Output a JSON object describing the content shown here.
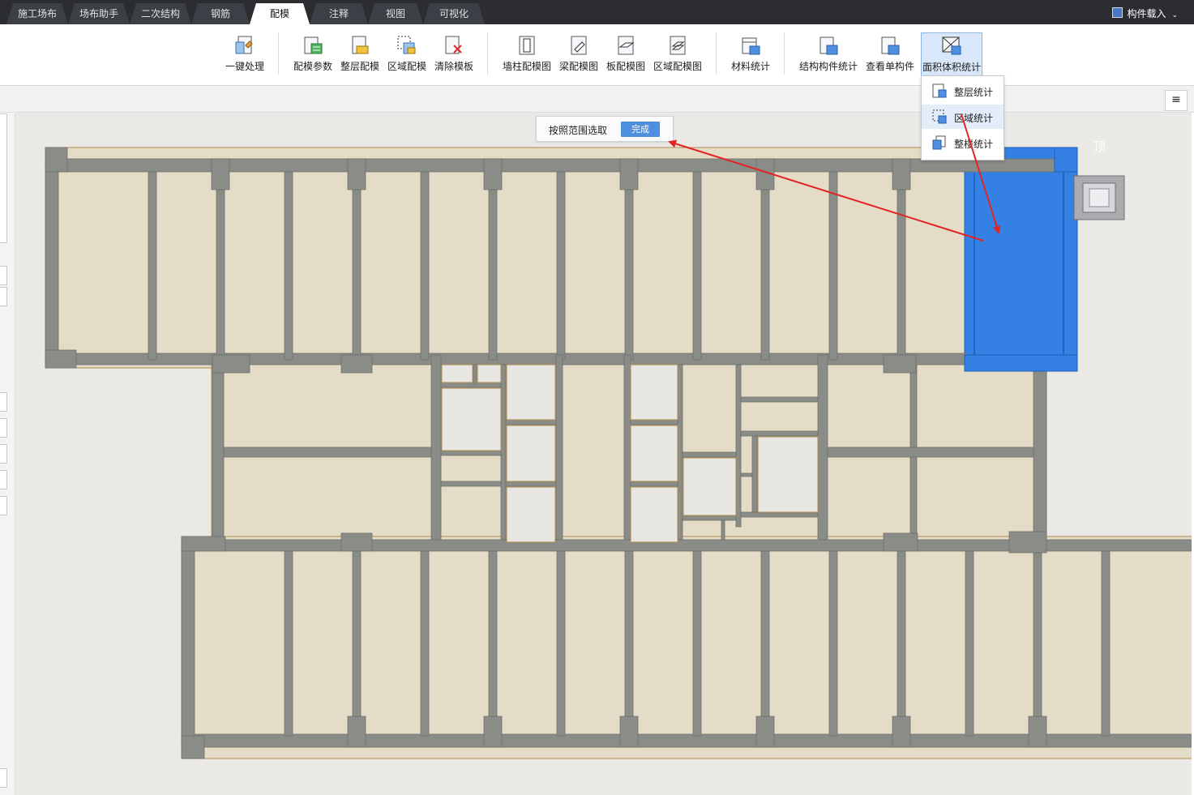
{
  "tabs": [
    {
      "label": "施工场布",
      "active": false
    },
    {
      "label": "场布助手",
      "active": false
    },
    {
      "label": "二次结构",
      "active": false
    },
    {
      "label": "钢筋",
      "active": false
    },
    {
      "label": "配模",
      "active": true
    },
    {
      "label": "注释",
      "active": false
    },
    {
      "label": "视图",
      "active": false
    },
    {
      "label": "可视化",
      "active": false
    }
  ],
  "top_right": {
    "label": "构件载入"
  },
  "ribbon": [
    {
      "label": "一键处理",
      "icon": "one-click-process-icon"
    },
    {
      "label": "配模参数",
      "icon": "formwork-params-icon"
    },
    {
      "label": "整层配模",
      "icon": "floor-formwork-icon"
    },
    {
      "label": "区域配模",
      "icon": "area-formwork-icon"
    },
    {
      "label": "清除模板",
      "icon": "clear-template-icon"
    },
    {
      "label": "墙柱配模图",
      "icon": "wall-column-drawing-icon"
    },
    {
      "label": "梁配模图",
      "icon": "beam-drawing-icon"
    },
    {
      "label": "板配模图",
      "icon": "slab-drawing-icon"
    },
    {
      "label": "区域配模图",
      "icon": "area-drawing-icon"
    },
    {
      "label": "材料统计",
      "icon": "material-stats-icon"
    },
    {
      "label": "结构构件统计",
      "icon": "structural-stats-icon"
    },
    {
      "label": "查看单构件",
      "icon": "view-component-icon"
    },
    {
      "label": "面积体积统计",
      "icon": "area-volume-stats-icon"
    }
  ],
  "prompt": {
    "text": "按照范围选取",
    "button": "完成"
  },
  "dropdown": [
    {
      "label": "整层统计",
      "highlighted": false
    },
    {
      "label": "区域统计",
      "highlighted": true
    },
    {
      "label": "整楼统计",
      "highlighted": false
    }
  ],
  "view_label": "顶",
  "menu_button": "≡",
  "colors": {
    "tabbar": "#2b2d31",
    "selection_blue": "#3580e3",
    "wall_gray": "#8a8c87",
    "slab_beige": "#e5dcc8",
    "arrow_red": "#e32424",
    "done_button": "#4f8fe0"
  }
}
